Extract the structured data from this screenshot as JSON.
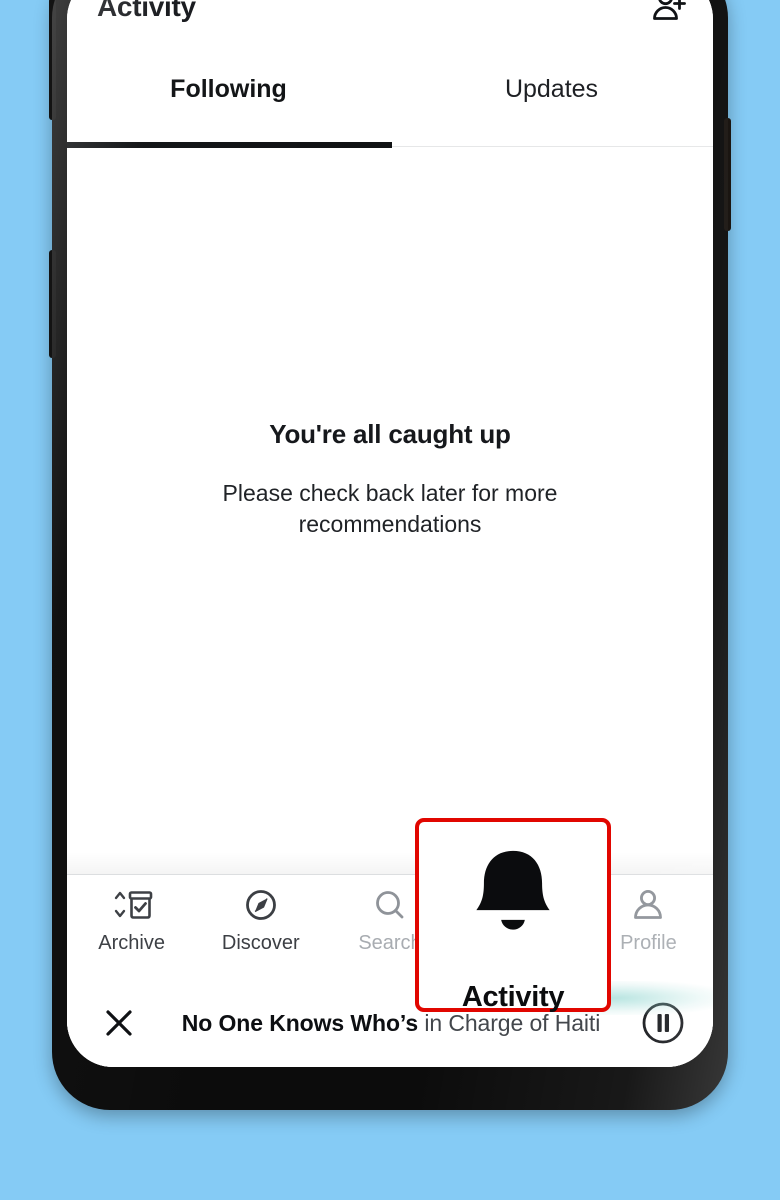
{
  "theme": {
    "page_background": "#85cbf5",
    "screen_background": "#ffffff",
    "accent_progress": "#079a8d",
    "highlight_annotation": "#e10600",
    "text_primary": "#16181c",
    "text_muted": "#a8acb1"
  },
  "header": {
    "title": "Activity",
    "add_person_icon": "add-person-icon"
  },
  "tabs": {
    "items": [
      {
        "label": "Following",
        "active": true
      },
      {
        "label": "Updates",
        "active": false
      }
    ]
  },
  "empty_state": {
    "title": "You're all caught up",
    "subtitle": "Please check back later for more recommendations"
  },
  "bottom_nav": {
    "items": [
      {
        "label": "Archive",
        "icon": "archive-box-check-icon",
        "state": "normal"
      },
      {
        "label": "Discover",
        "icon": "compass-icon",
        "state": "normal"
      },
      {
        "label": "Search",
        "icon": "search-icon",
        "state": "dimmed"
      },
      {
        "label": "Activity",
        "icon": "bell-icon",
        "state": "active"
      },
      {
        "label": "Profile",
        "icon": "person-icon",
        "state": "dimmed"
      }
    ]
  },
  "playback": {
    "progress_percent": 84
  },
  "mini_player": {
    "close_icon": "close-icon",
    "title_lead": "No One Knows Who’s",
    "title_rest": " in Charge of Haiti",
    "pause_icon": "pause-icon"
  },
  "annotation": {
    "target_label": "Activity",
    "target_icon": "bell-icon",
    "border_color": "#e10600"
  }
}
